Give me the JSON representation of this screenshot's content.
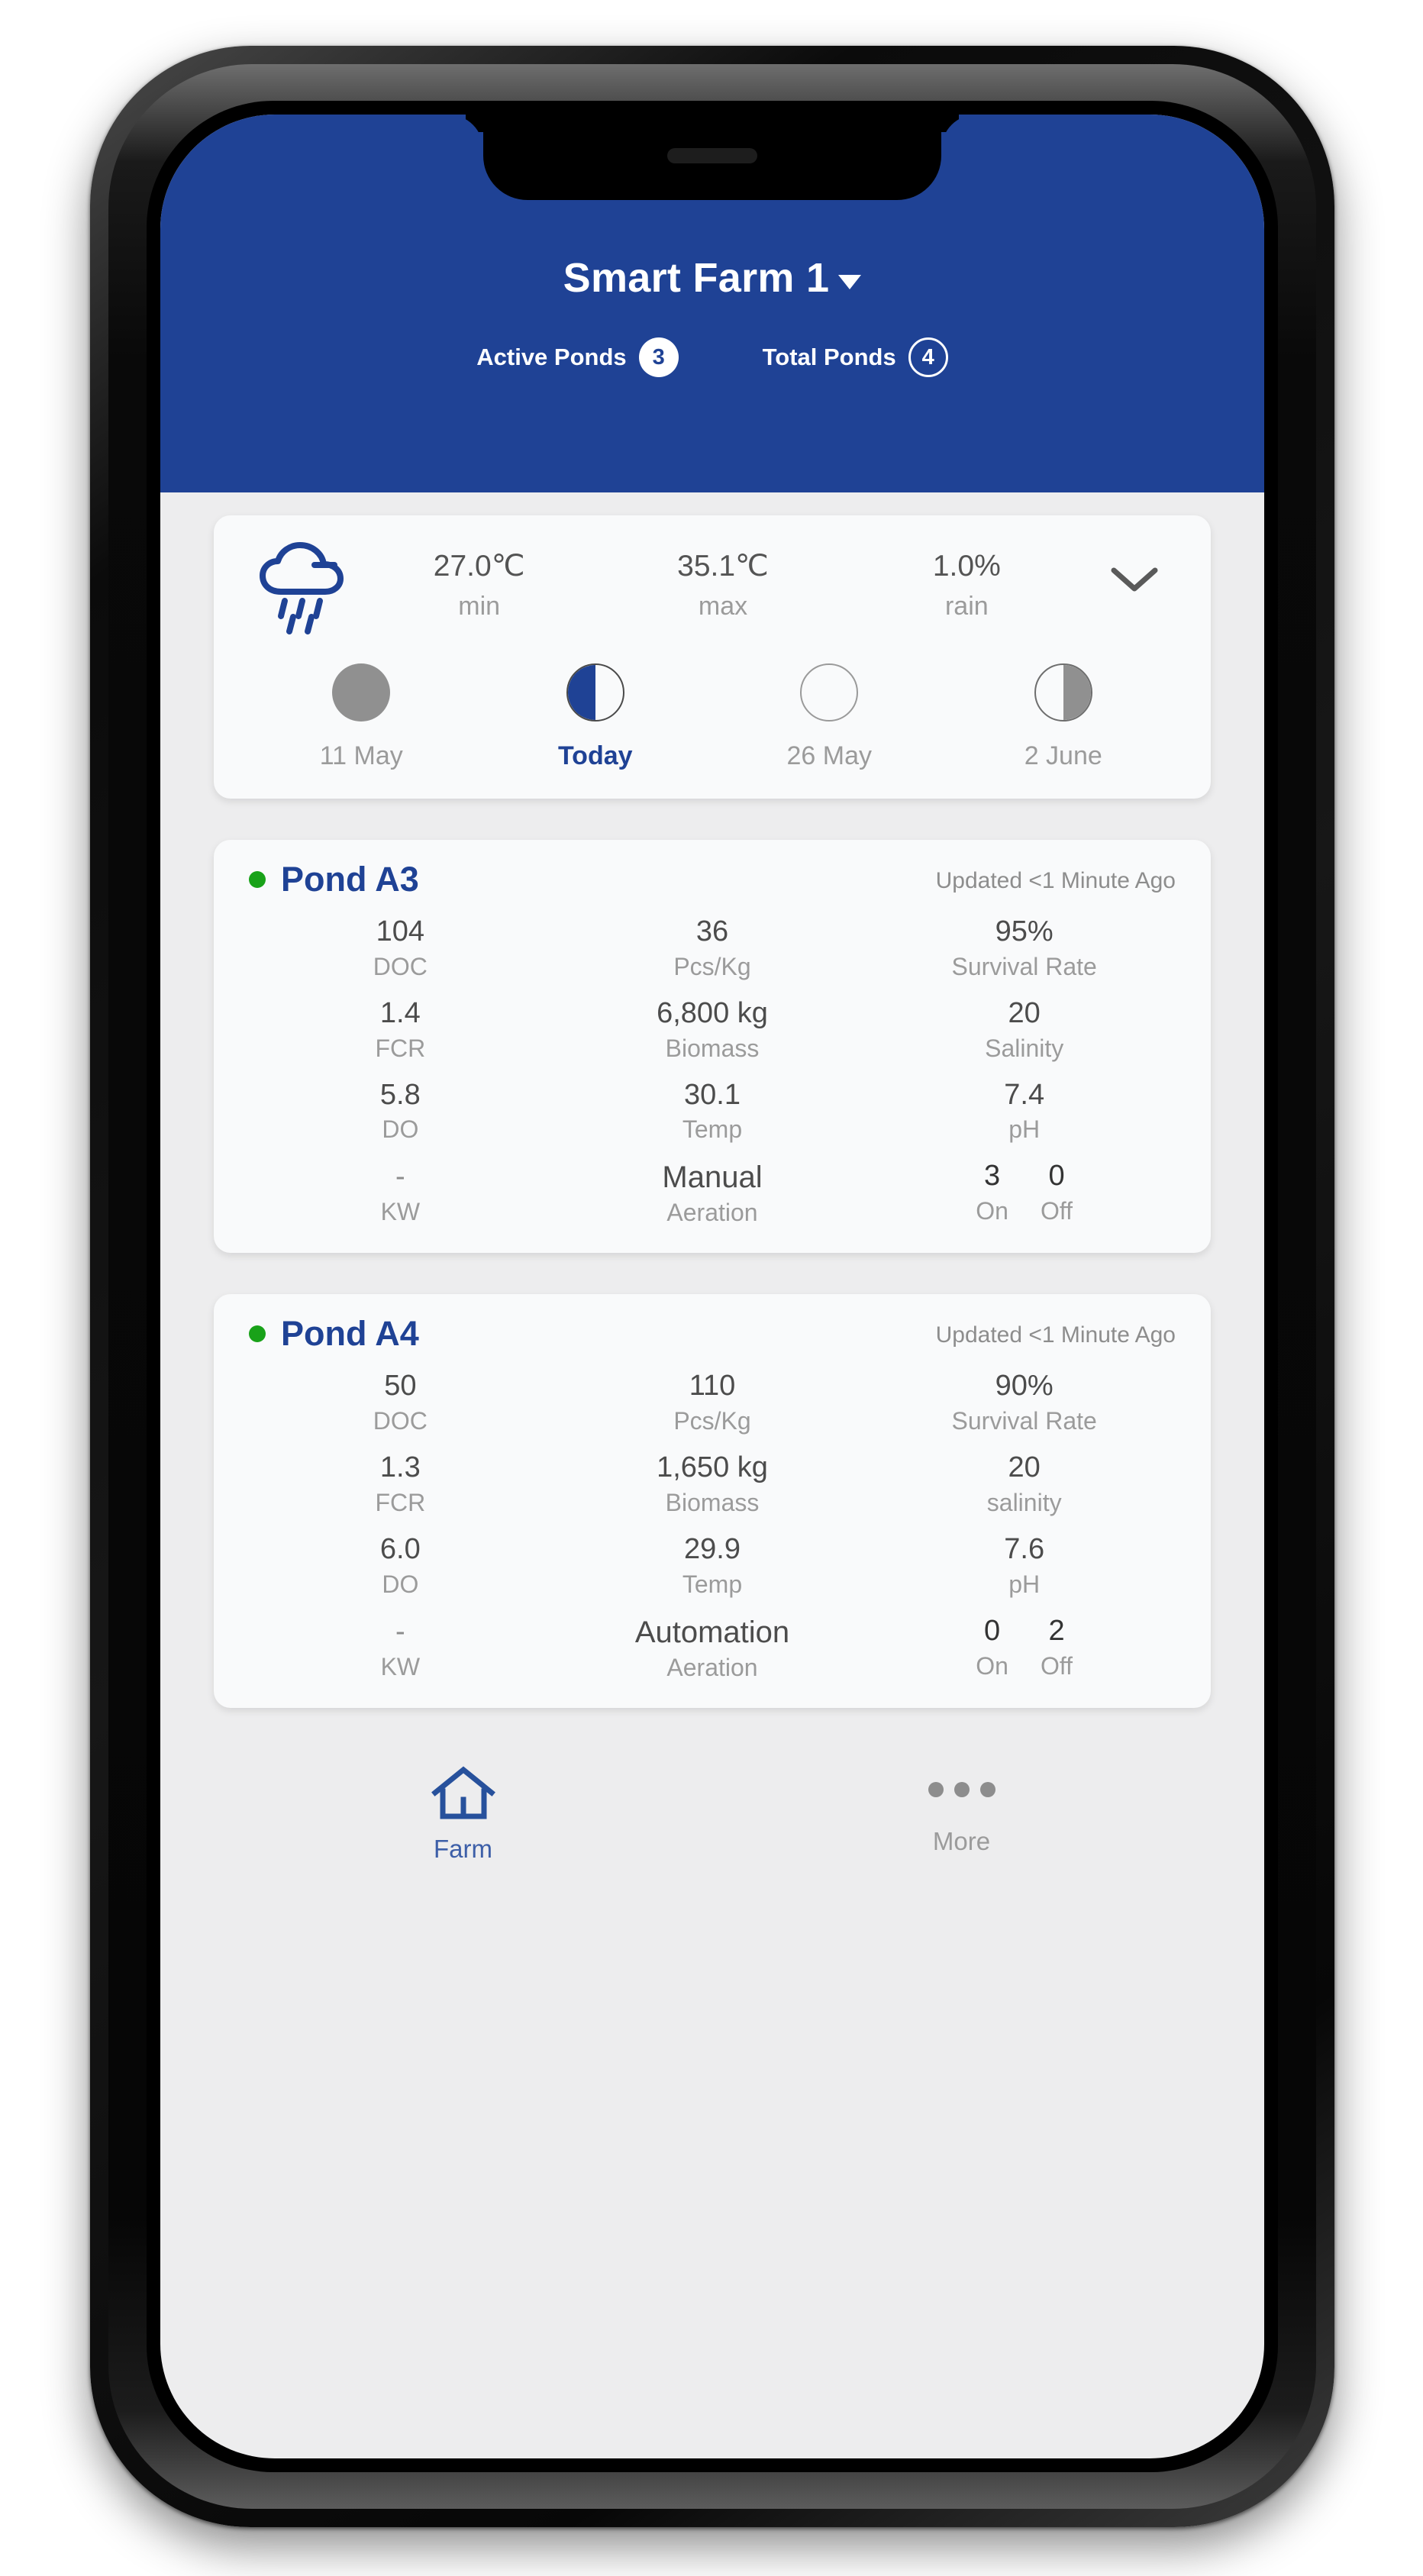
{
  "header": {
    "farm_title": "Smart Farm 1",
    "dropdown_icon": "caret-down-icon",
    "active_ponds_label": "Active Ponds",
    "active_ponds_count": "3",
    "total_ponds_label": "Total Ponds",
    "total_ponds_count": "4",
    "background_color": "#1f4295"
  },
  "weather": {
    "icon": "rain-cloud-icon",
    "expand_icon": "chevron-down-icon",
    "stats": [
      {
        "value": "27.0℃",
        "label": "min"
      },
      {
        "value": "35.1℃",
        "label": "max"
      },
      {
        "value": "1.0%",
        "label": "rain"
      }
    ],
    "moon_phases": [
      {
        "label": "11 May",
        "phase": "full-gray",
        "active": false
      },
      {
        "label": "Today",
        "phase": "half-left-blue",
        "active": true
      },
      {
        "label": "26 May",
        "phase": "empty",
        "active": false
      },
      {
        "label": "2 June",
        "phase": "half-right-gray",
        "active": false
      }
    ]
  },
  "ponds": [
    {
      "status": "online",
      "name": "Pond A3",
      "updated": "Updated <1 Minute Ago",
      "rows": [
        [
          {
            "value": "104",
            "label": "DOC"
          },
          {
            "value": "36",
            "label": "Pcs/Kg"
          },
          {
            "value": "95%",
            "label": "Survival Rate"
          }
        ],
        [
          {
            "value": "1.4",
            "label": "FCR"
          },
          {
            "value": "6,800 kg",
            "label": "Biomass"
          },
          {
            "value": "20",
            "label": "Salinity"
          }
        ],
        [
          {
            "value": "5.8",
            "label": "DO"
          },
          {
            "value": "30.1",
            "label": "Temp"
          },
          {
            "value": "7.4",
            "label": "pH"
          }
        ]
      ],
      "aeration": {
        "kw_value": "-",
        "kw_label": "KW",
        "mode_value": "Manual",
        "mode_label": "Aeration",
        "on_value": "3",
        "on_label": "On",
        "off_value": "0",
        "off_label": "Off"
      }
    },
    {
      "status": "online",
      "name": "Pond A4",
      "updated": "Updated <1 Minute Ago",
      "rows": [
        [
          {
            "value": "50",
            "label": "DOC"
          },
          {
            "value": "110",
            "label": "Pcs/Kg"
          },
          {
            "value": "90%",
            "label": "Survival Rate"
          }
        ],
        [
          {
            "value": "1.3",
            "label": "FCR"
          },
          {
            "value": "1,650 kg",
            "label": "Biomass"
          },
          {
            "value": "20",
            "label": "salinity"
          }
        ],
        [
          {
            "value": "6.0",
            "label": "DO"
          },
          {
            "value": "29.9",
            "label": "Temp"
          },
          {
            "value": "7.6",
            "label": "pH"
          }
        ]
      ],
      "aeration": {
        "kw_value": "-",
        "kw_label": "KW",
        "mode_value": "Automation",
        "mode_label": "Aeration",
        "on_value": "0",
        "on_label": "On",
        "off_value": "2",
        "off_label": "Off"
      }
    }
  ],
  "bottom_nav": {
    "items": [
      {
        "icon": "home-icon",
        "label": "Farm",
        "active": true
      },
      {
        "icon": "more-dots-icon",
        "label": "More",
        "active": false
      }
    ]
  },
  "colors": {
    "brand_blue": "#1f4295",
    "status_green": "#19a219",
    "page_bg": "#ededee",
    "card_bg": "#f9fafb",
    "muted_text": "#9b9b9b"
  }
}
